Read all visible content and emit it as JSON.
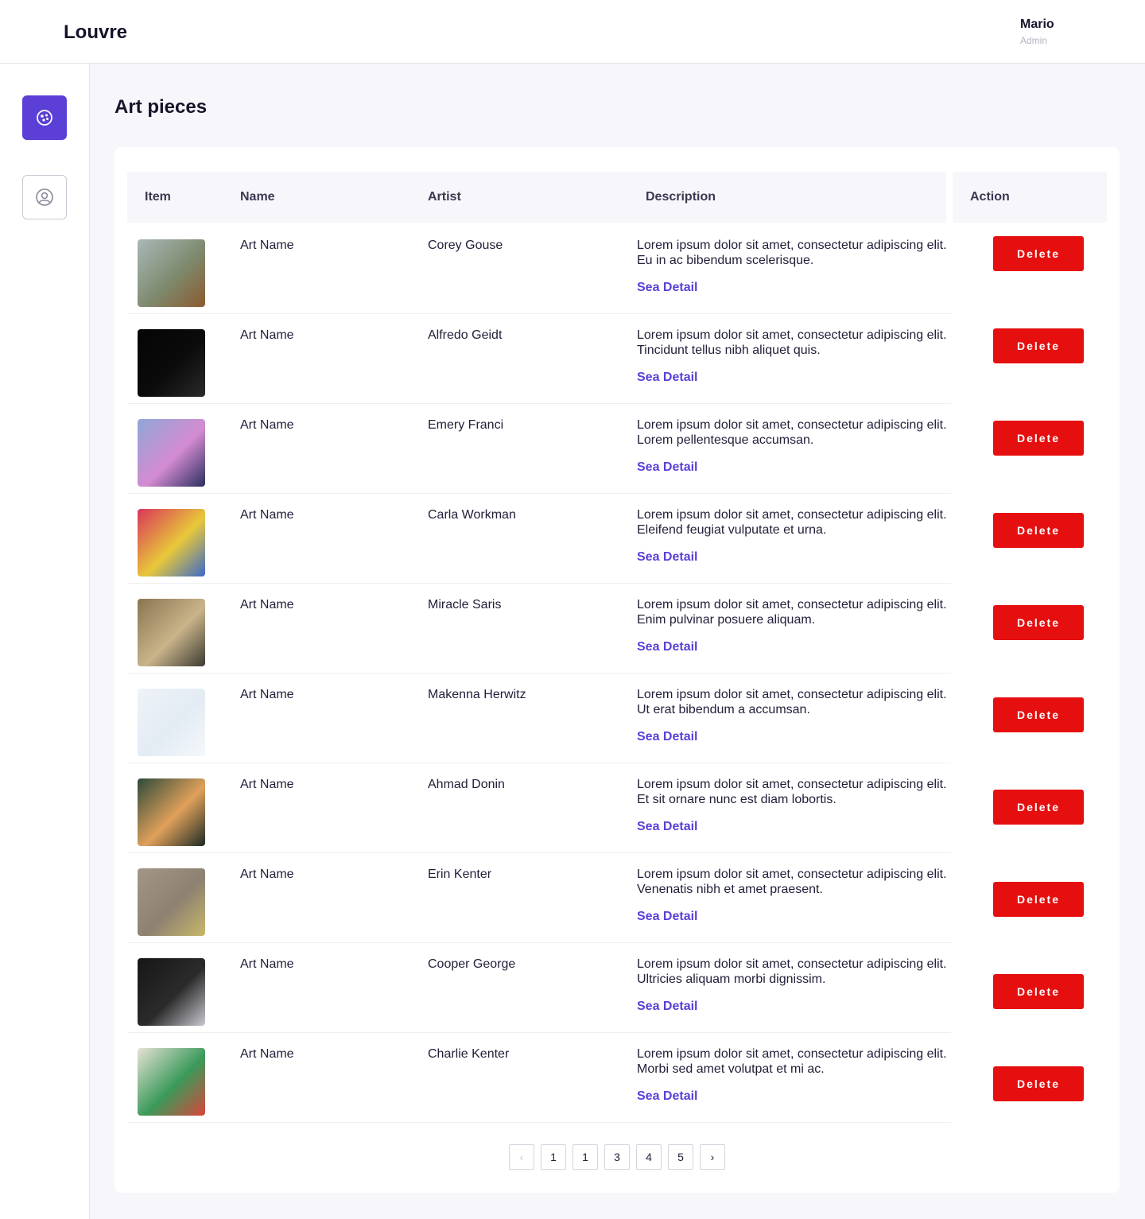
{
  "app": {
    "brand": "Louvre"
  },
  "user": {
    "name": "Mario",
    "role": "Admin"
  },
  "page": {
    "title": "Art pieces"
  },
  "table": {
    "headers": {
      "item": "Item",
      "name": "Name",
      "artist": "Artist",
      "description": "Description",
      "action": "Action"
    },
    "detail_label": "Sea Detail",
    "delete_label": "Delete",
    "rows": [
      {
        "name": "Art Name",
        "artist": "Corey Gouse",
        "description": "Lorem ipsum dolor sit amet, consectetur adipiscing elit. Eu in ac bibendum scelerisque.",
        "thumb": {
          "c1": "#a9b8b8",
          "c2": "#7e8a6e",
          "c3": "#8a5a2e"
        }
      },
      {
        "name": "Art Name",
        "artist": "Alfredo Geidt",
        "description": "Lorem ipsum dolor sit amet, consectetur adipiscing elit. Tincidunt tellus nibh aliquet quis.",
        "thumb": {
          "c1": "#050505",
          "c2": "#0b0b0b",
          "c3": "#2a2a2a"
        }
      },
      {
        "name": "Art Name",
        "artist": "Emery Franci",
        "description": "Lorem ipsum dolor sit amet, consectetur adipiscing elit. Lorem pellentesque accumsan.",
        "thumb": {
          "c1": "#8fa7d8",
          "c2": "#d48bd1",
          "c3": "#2a2f5e"
        }
      },
      {
        "name": "Art Name",
        "artist": "Carla Workman",
        "description": "Lorem ipsum dolor sit amet, consectetur adipiscing elit. Eleifend feugiat vulputate et urna.",
        "thumb": {
          "c1": "#d9355a",
          "c2": "#e8c83a",
          "c3": "#3a6ac9"
        }
      },
      {
        "name": "Art Name",
        "artist": "Miracle Saris",
        "description": "Lorem ipsum dolor sit amet, consectetur adipiscing elit. Enim pulvinar posuere aliquam.",
        "thumb": {
          "c1": "#8a7450",
          "c2": "#c9b48a",
          "c3": "#3b3a32"
        }
      },
      {
        "name": "Art Name",
        "artist": "Makenna Herwitz",
        "description": "Lorem ipsum dolor sit amet, consectetur adipiscing elit. Ut erat bibendum a accumsan.",
        "thumb": {
          "c1": "#eef3f8",
          "c2": "#e3ebf4",
          "c3": "#f5f8fb"
        }
      },
      {
        "name": "Art Name",
        "artist": "Ahmad Donin",
        "description": "Lorem ipsum dolor sit amet, consectetur adipiscing elit. Et sit ornare nunc est diam lobortis.",
        "thumb": {
          "c1": "#2d4a3a",
          "c2": "#e0a05a",
          "c3": "#1c2b25"
        }
      },
      {
        "name": "Art Name",
        "artist": "Erin Kenter",
        "description": "Lorem ipsum dolor sit amet, consectetur adipiscing elit. Venenatis nibh et amet praesent.",
        "thumb": {
          "c1": "#a29686",
          "c2": "#8d8172",
          "c3": "#c9b86a"
        }
      },
      {
        "name": "Art Name",
        "artist": "Cooper George",
        "description": "Lorem ipsum dolor sit amet, consectetur adipiscing elit. Ultricies aliquam morbi dignissim.",
        "thumb": {
          "c1": "#161616",
          "c2": "#2b2b2b",
          "c3": "#c8c8d0"
        }
      },
      {
        "name": "Art Name",
        "artist": "Charlie Kenter",
        "description": "Lorem ipsum dolor sit amet, consectetur adipiscing elit. Morbi sed amet volutpat et mi ac.",
        "thumb": {
          "c1": "#e8e2d6",
          "c2": "#3a9a5a",
          "c3": "#d9453a"
        }
      }
    ]
  },
  "pagination": {
    "prev": "‹",
    "next": "›",
    "pages": [
      "1",
      "1",
      "3",
      "4",
      "5"
    ]
  },
  "colors": {
    "accent": "#5b3fd6",
    "danger": "#e60f0f"
  }
}
